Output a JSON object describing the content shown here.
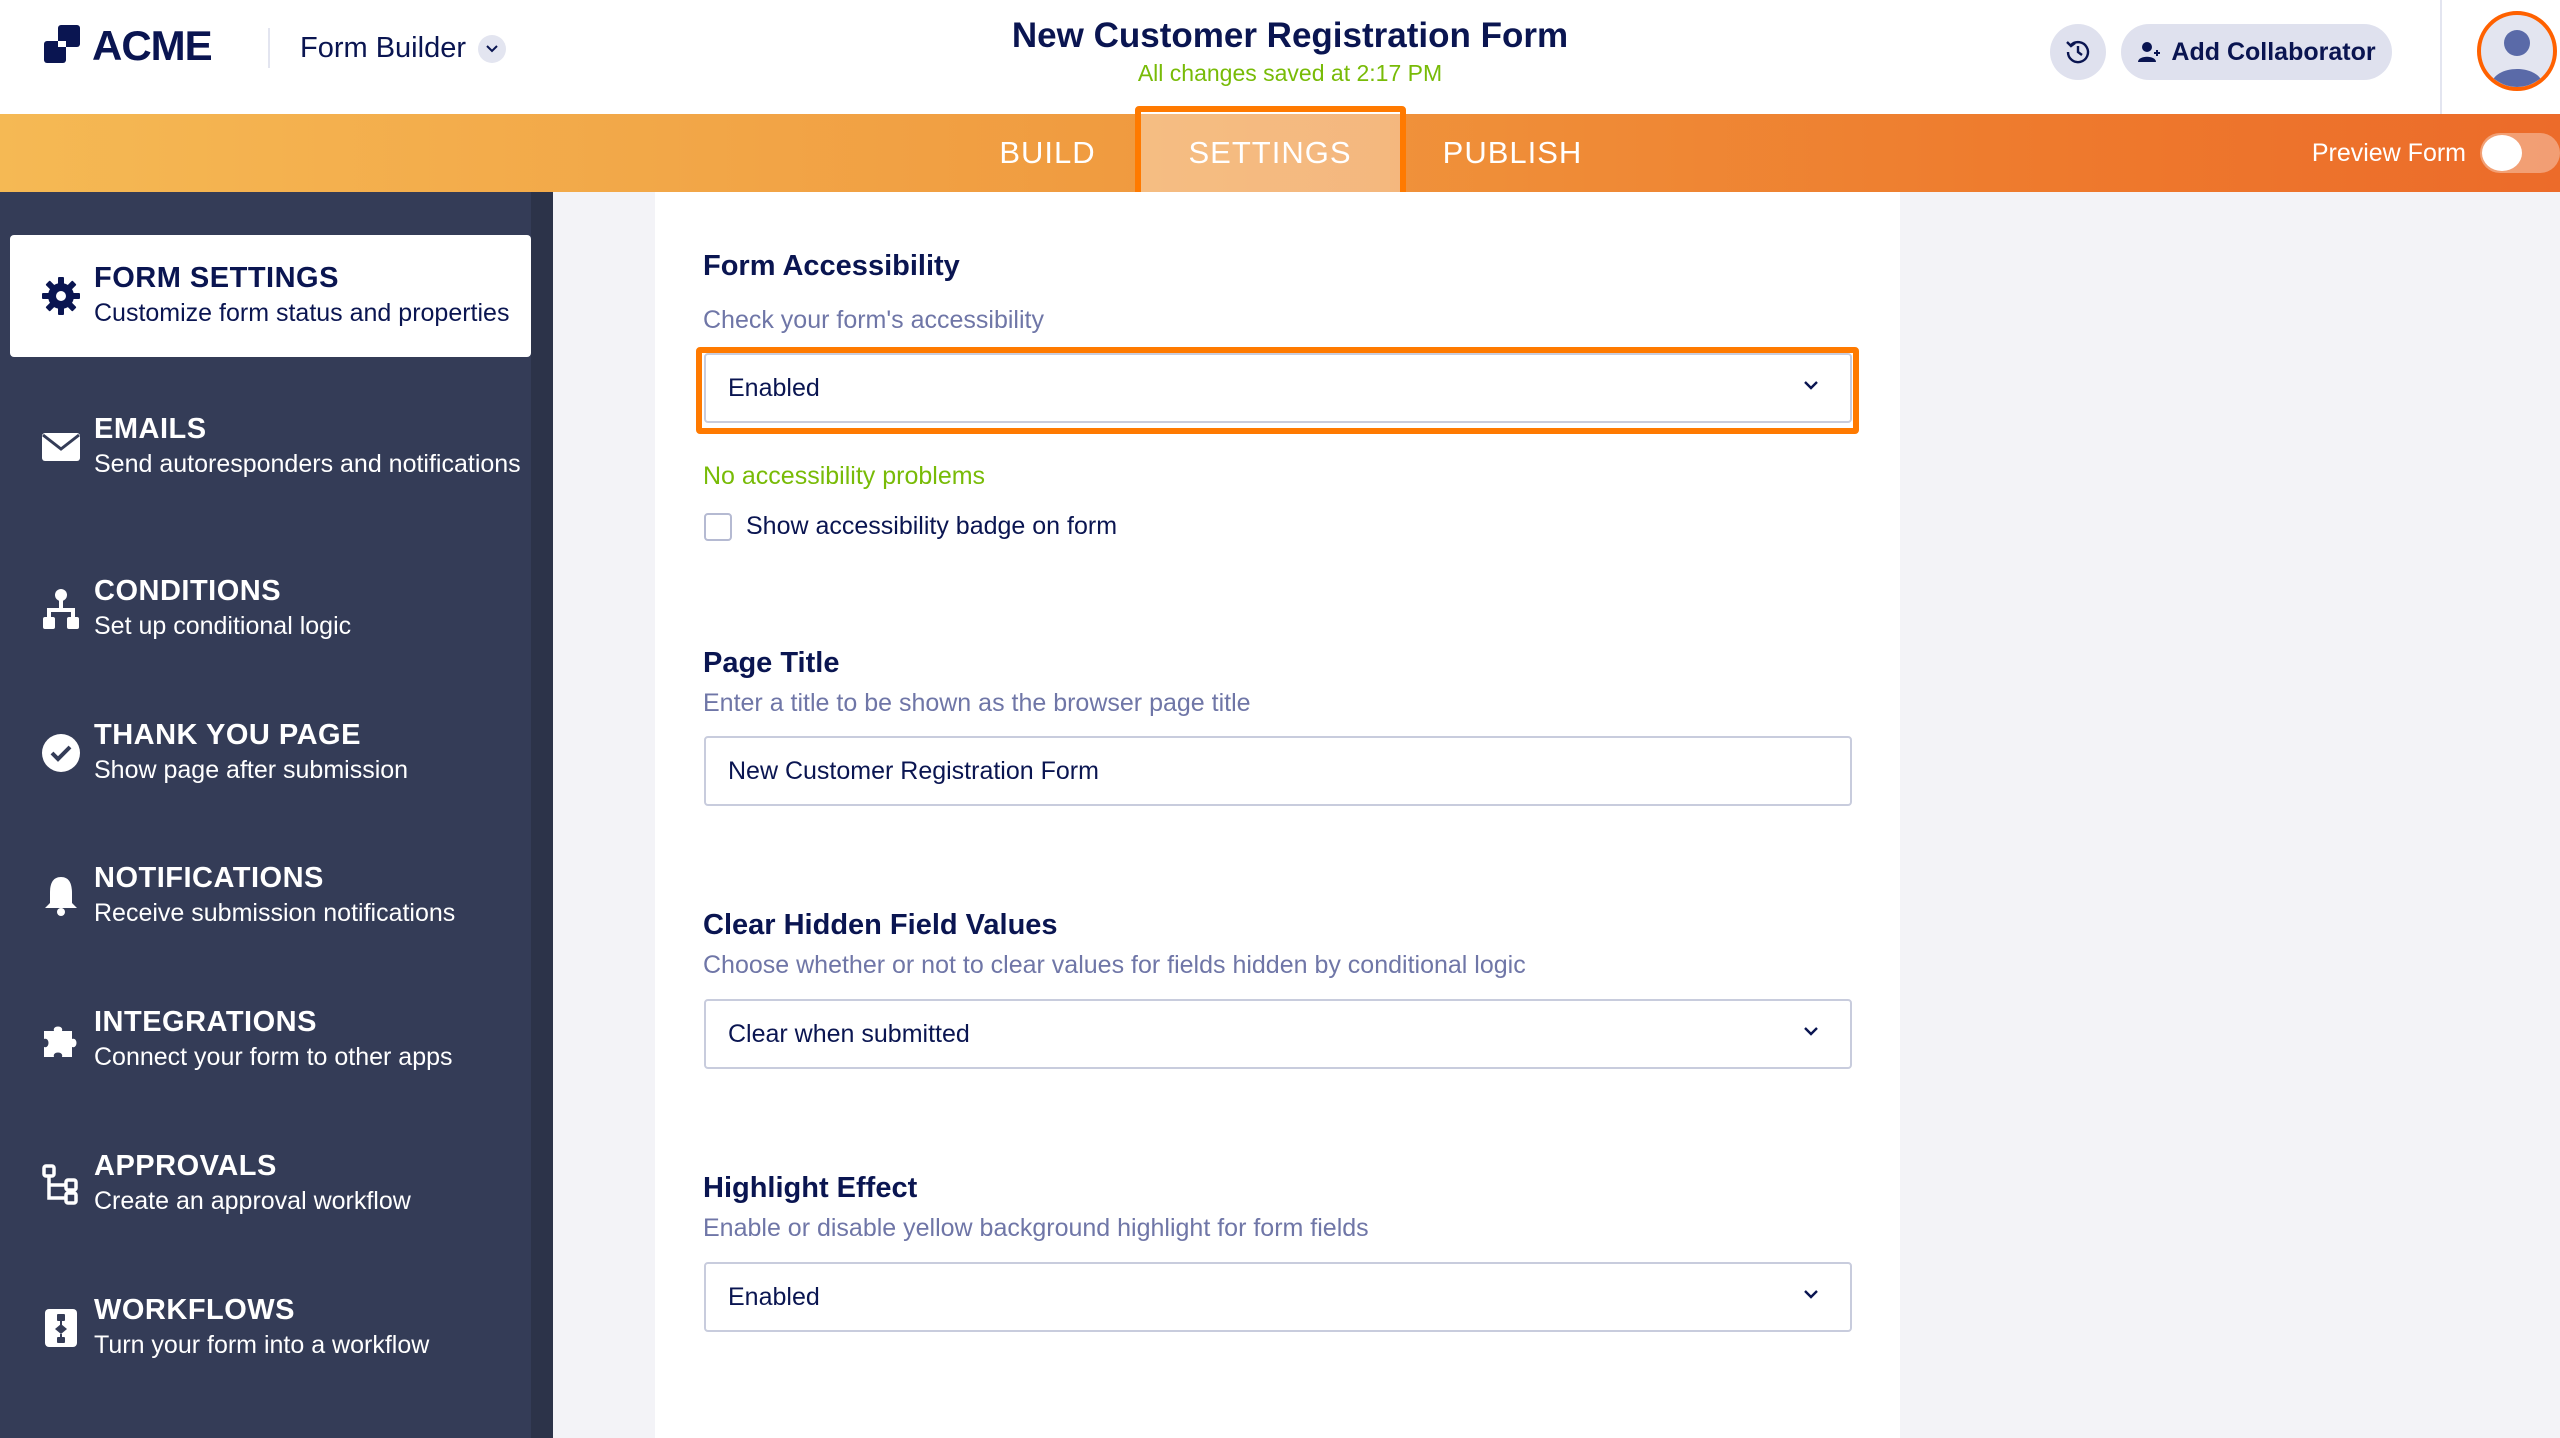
{
  "header": {
    "logo_text": "ACME",
    "app_name": "Form Builder",
    "form_title": "New Customer Registration Form",
    "save_status": "All changes saved at 2:17 PM",
    "add_collaborator_label": "Add Collaborator"
  },
  "nav": {
    "tabs": [
      {
        "label": "BUILD"
      },
      {
        "label": "SETTINGS"
      },
      {
        "label": "PUBLISH"
      }
    ],
    "active_tab": "SETTINGS",
    "preview_label": "Preview Form",
    "preview_on": false
  },
  "sidebar": {
    "items": [
      {
        "title": "FORM SETTINGS",
        "desc": "Customize form status and properties",
        "icon": "gear-icon"
      },
      {
        "title": "EMAILS",
        "desc": "Send autoresponders and notifications",
        "icon": "envelope-icon"
      },
      {
        "title": "CONDITIONS",
        "desc": "Set up conditional logic",
        "icon": "hierarchy-icon"
      },
      {
        "title": "THANK YOU PAGE",
        "desc": "Show page after submission",
        "icon": "check-circle-icon"
      },
      {
        "title": "NOTIFICATIONS",
        "desc": "Receive submission notifications",
        "icon": "bell-icon"
      },
      {
        "title": "INTEGRATIONS",
        "desc": "Connect your form to other apps",
        "icon": "puzzle-icon"
      },
      {
        "title": "APPROVALS",
        "desc": "Create an approval workflow",
        "icon": "approval-flow-icon"
      },
      {
        "title": "WORKFLOWS",
        "desc": "Turn your form into a workflow",
        "icon": "workflow-icon"
      }
    ]
  },
  "settings": {
    "accessibility": {
      "title": "Form Accessibility",
      "desc": "Check your form's accessibility",
      "value": "Enabled",
      "status": "No accessibility problems",
      "badge_label": "Show accessibility badge on form",
      "badge_checked": false
    },
    "page_title": {
      "title": "Page Title",
      "desc": "Enter a title to be shown as the browser page title",
      "value": "New Customer Registration Form"
    },
    "clear_hidden": {
      "title": "Clear Hidden Field Values",
      "desc": "Choose whether or not to clear values for fields hidden by conditional logic",
      "value": "Clear when submitted"
    },
    "highlight": {
      "title": "Highlight Effect",
      "desc": "Enable or disable yellow background highlight for form fields",
      "value": "Enabled"
    }
  },
  "colors": {
    "accent": "#ff7a00",
    "navy": "#0a1551",
    "sidebar_bg": "#343c57",
    "success": "#78bb07"
  }
}
